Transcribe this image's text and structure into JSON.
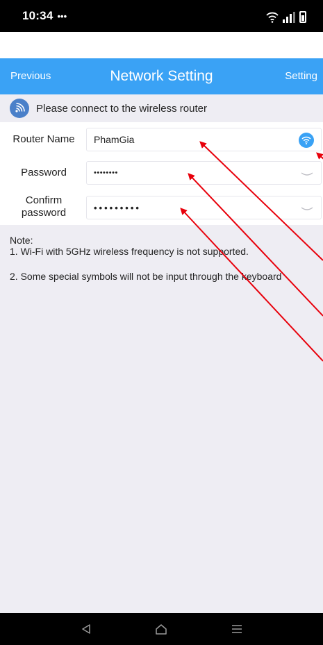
{
  "status_bar": {
    "time": "10:34",
    "dots": "•••"
  },
  "nav": {
    "back_label": "Previous",
    "title": "Network Setting",
    "action_label": "Setting"
  },
  "hint": {
    "text": "Please connect to the wireless router"
  },
  "form": {
    "router_name": {
      "label": "Router Name",
      "value": "PhamGia"
    },
    "password": {
      "label": "Password",
      "value": "••••••••"
    },
    "confirm_password": {
      "label_line1": "Confirm",
      "label_line2": "password",
      "value": "•••••••••"
    }
  },
  "notes": {
    "heading": "Note:",
    "line1": "1. Wi-Fi with 5GHz wireless frequency is not supported.",
    "line2": "2. Some special symbols will not be input through the keyboard"
  },
  "colors": {
    "accent": "#3aa2f5",
    "hint_icon": "#4a80c9",
    "background": "#eeedf3",
    "annotation": "#e8000b"
  },
  "icons": {
    "hint": "wifi-signal-icon",
    "router": "wifi-icon",
    "password_toggle": "eye-closed-icon",
    "back": "back-triangle-icon",
    "home": "home-icon",
    "menu": "menu-lines-icon"
  }
}
